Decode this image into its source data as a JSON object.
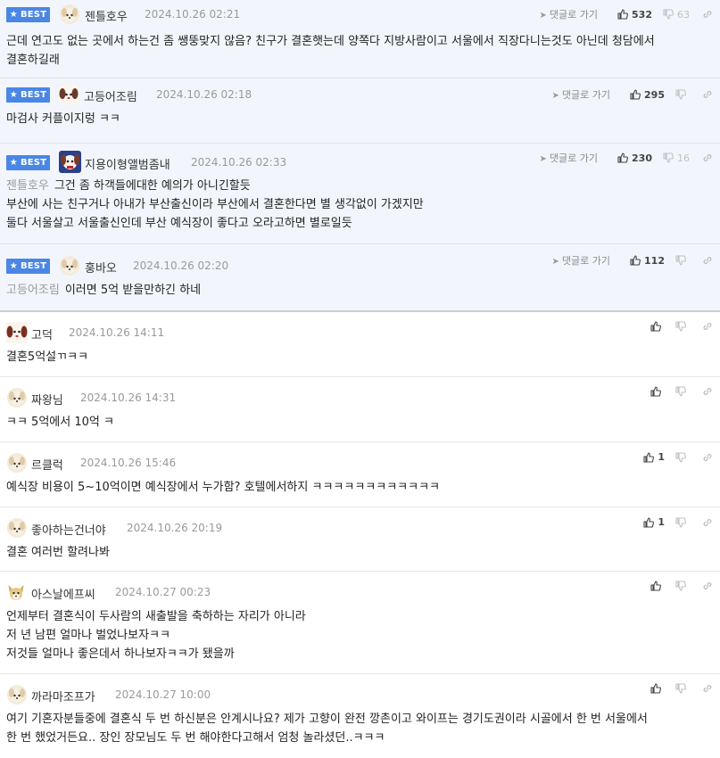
{
  "ui": {
    "best_label": "BEST",
    "reply_label": "댓글로 가기"
  },
  "comments": [
    {
      "best": true,
      "nick": "젠틀호우",
      "date": "2024.10.26 02:21",
      "up": "532",
      "down": "63",
      "mention": "",
      "lines": [
        "근데 연고도 없는 곳에서 하는건 좀 쌩뚱맞지 않음? 친구가 결혼햇는데 양쪽다 지방사람이고 서울에서 직장다니는것도 아닌데 청담에서",
        "결혼하길래"
      ]
    },
    {
      "best": true,
      "nick": "고등어조림",
      "date": "2024.10.26 02:18",
      "up": "295",
      "down": "",
      "mention": "",
      "lines": [
        "마검사 커플이지렁 ㅋㅋ"
      ]
    },
    {
      "best": true,
      "nick": "지용이형앨범좀내",
      "date": "2024.10.26 02:33",
      "up": "230",
      "down": "16",
      "mention": "젠틀호우",
      "lines": [
        "그건 좀 하객들에대한 예의가 아니긴할듯",
        "부산에 사는 친구거나 아내가 부산출신이라 부산에서 결혼한다면 별 생각없이 가겠지만",
        "둘다 서울살고 서울출신인데 부산 예식장이 좋다고 오라고하면 별로일듯"
      ]
    },
    {
      "best": true,
      "nick": "훙바오",
      "date": "2024.10.26 02:20",
      "up": "112",
      "down": "",
      "mention": "고등어조림",
      "lines": [
        "이러면 5억 받을만하긴 하네"
      ]
    },
    {
      "best": false,
      "nick": "고덕",
      "date": "2024.10.26 14:11",
      "up": "",
      "down": "",
      "mention": "",
      "lines": [
        "결혼5억설ㄲㅋㅋ"
      ]
    },
    {
      "best": false,
      "nick": "짜왕님",
      "date": "2024.10.26 14:31",
      "up": "",
      "down": "",
      "mention": "",
      "lines": [
        "ㅋㅋ 5억에서 10억 ㅋ"
      ]
    },
    {
      "best": false,
      "nick": "르클럭",
      "date": "2024.10.26 15:46",
      "up": "1",
      "down": "",
      "mention": "",
      "lines": [
        "예식장 비용이 5~10억이면 예식장에서 누가함? 호텔에서하지 ㅋㅋㅋㅋㅋㅋㅋㅋㅋㅋㅋㅋ"
      ]
    },
    {
      "best": false,
      "nick": "좋아하는건너야",
      "date": "2024.10.26 20:19",
      "up": "1",
      "down": "",
      "mention": "",
      "lines": [
        "결혼 여러번 할려나봐"
      ]
    },
    {
      "best": false,
      "nick": "아스날에프씨",
      "date": "2024.10.27 00:23",
      "up": "",
      "down": "",
      "mention": "",
      "lines": [
        "언제부터 결혼식이 두사람의 새출발을 축하하는 자리가 아니라",
        "저 년 남편 얼마나 벌었나보자ㅋㅋ",
        "저것들 얼마나 좋은데서 하나보자ㅋㅋ가 됐을까"
      ]
    },
    {
      "best": false,
      "nick": "까라마조프가",
      "date": "2024.10.27 10:00",
      "up": "",
      "down": "",
      "mention": "",
      "lines": [
        "여기 기혼자분들중에 결혼식 두 번 하신분은 안계시나요? 제가 고향이 완전 깡촌이고 와이프는 경기도권이라 시골에서 한 번 서울에서",
        "한 번 했었거든요.. 장인 장모님도 두 번 해야한다고해서 엄청 놀라셨던..ㅋㅋㅋ"
      ]
    }
  ]
}
